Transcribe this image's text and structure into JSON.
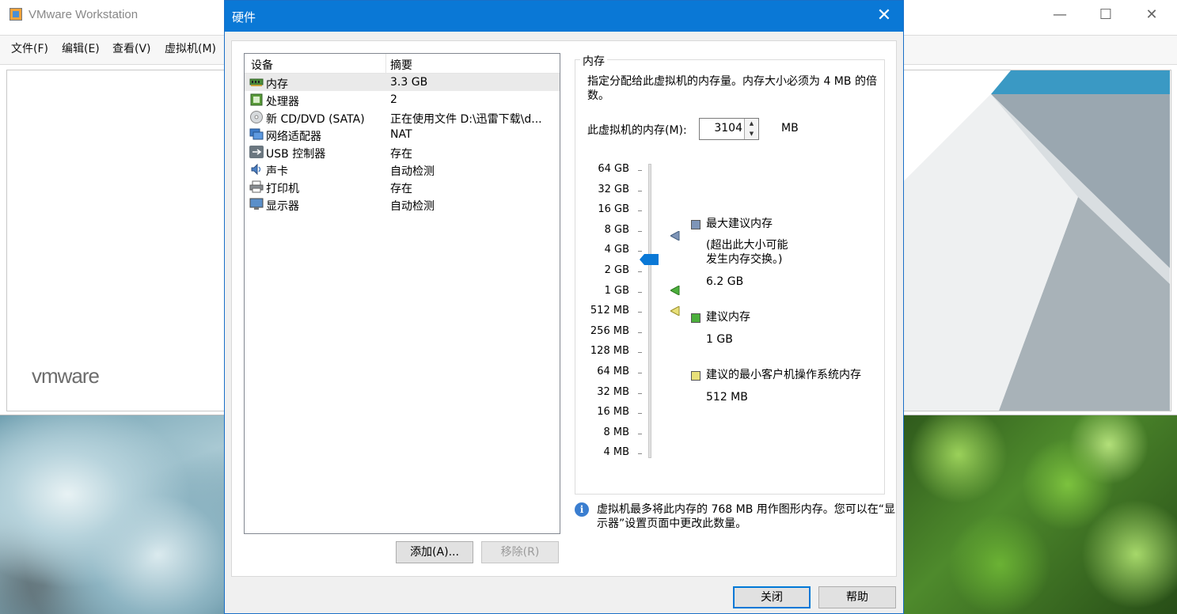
{
  "main": {
    "title": "VMware Workstation",
    "menu": [
      "文件(F)",
      "编辑(E)",
      "查看(V)",
      "虚拟机(M)"
    ],
    "logo": "vmware",
    "win_controls": [
      "—",
      "☐",
      "✕"
    ]
  },
  "dialog": {
    "title": "硬件",
    "close_glyph": "✕",
    "columns": {
      "device": "设备",
      "summary": "摘要"
    },
    "devices": [
      {
        "name": "内存",
        "summary": "3.3 GB",
        "icon": "memory-icon",
        "selected": true
      },
      {
        "name": "处理器",
        "summary": "2",
        "icon": "processor-icon"
      },
      {
        "name": "新 CD/DVD (SATA)",
        "summary": "正在使用文件 D:\\迅雷下载\\d...",
        "icon": "cd-dvd-icon"
      },
      {
        "name": "网络适配器",
        "summary": "NAT",
        "icon": "network-adapter-icon"
      },
      {
        "name": "USB 控制器",
        "summary": "存在",
        "icon": "usb-icon"
      },
      {
        "name": "声卡",
        "summary": "自动检测",
        "icon": "sound-card-icon"
      },
      {
        "name": "打印机",
        "summary": "存在",
        "icon": "printer-icon"
      },
      {
        "name": "显示器",
        "summary": "自动检测",
        "icon": "display-icon"
      }
    ],
    "add_button": "添加(A)...",
    "remove_button": "移除(R)",
    "close_button": "关闭",
    "help_button": "帮助",
    "memory": {
      "group_title": "内存",
      "description": "指定分配给此虚拟机的内存量。内存大小必须为 4 MB 的倍数。",
      "input_label": "此虚拟机的内存(M):",
      "value": "3104",
      "unit": "MB",
      "scale": [
        "64 GB",
        "32 GB",
        "16 GB",
        "8 GB",
        "4 GB",
        "2 GB",
        "1 GB",
        "512 MB",
        "256 MB",
        "128 MB",
        "64 MB",
        "32 MB",
        "16 MB",
        "8 MB",
        "4 MB"
      ],
      "max_recommended": {
        "title": "最大建议内存",
        "note_line1": "(超出此大小可能",
        "note_line2": "发生内存交换。)",
        "value": "6.2 GB",
        "color": "#7e95b8"
      },
      "recommended": {
        "title": "建议内存",
        "value": "1 GB",
        "color": "#4caf3c"
      },
      "min_recommended": {
        "title": "建议的最小客户机操作系统内存",
        "value": "512 MB",
        "color": "#e8e07a"
      },
      "thumb_color": "#0a78d6"
    },
    "info_text": "虚拟机最多将此内存的 768 MB 用作图形内存。您可以在“显示器”设置页面中更改此数量。"
  }
}
